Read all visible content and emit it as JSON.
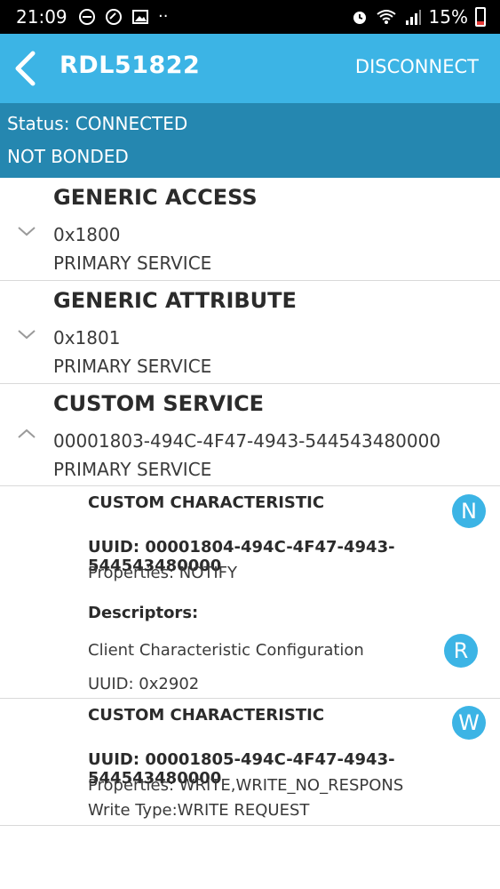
{
  "status_bar": {
    "time": "21:09",
    "battery": "15%"
  },
  "app_bar": {
    "title": "RDL51822",
    "action": "DISCONNECT"
  },
  "connection": {
    "status": "Status: CONNECTED",
    "bond": "NOT BONDED"
  },
  "services": [
    {
      "name": "GENERIC ACCESS",
      "uuid": "0x1800",
      "type": "PRIMARY SERVICE"
    },
    {
      "name": "GENERIC ATTRIBUTE",
      "uuid": "0x1801",
      "type": "PRIMARY SERVICE"
    },
    {
      "name": "CUSTOM SERVICE",
      "uuid": "00001803-494C-4F47-4943-544543480000",
      "type": "PRIMARY SERVICE"
    }
  ],
  "characteristics": [
    {
      "name": "CUSTOM CHARACTERISTIC",
      "uuid": "UUID: 00001804-494C-4F47-4943-544543480000",
      "properties": "Properties: NOTIFY",
      "badge": "N",
      "descriptors_label": "Descriptors:",
      "descriptor": {
        "name": "Client Characteristic Configuration",
        "uuid": "UUID: 0x2902",
        "badge": "R"
      }
    },
    {
      "name": "CUSTOM CHARACTERISTIC",
      "uuid": "UUID: 00001805-494C-4F47-4943-544543480000",
      "properties": "Properties: WRITE,WRITE_NO_RESPONS",
      "write_type": "Write Type:WRITE REQUEST",
      "badge": "W"
    }
  ],
  "colors": {
    "primary": "#3cb4e5",
    "status_panel": "#2587b0"
  }
}
